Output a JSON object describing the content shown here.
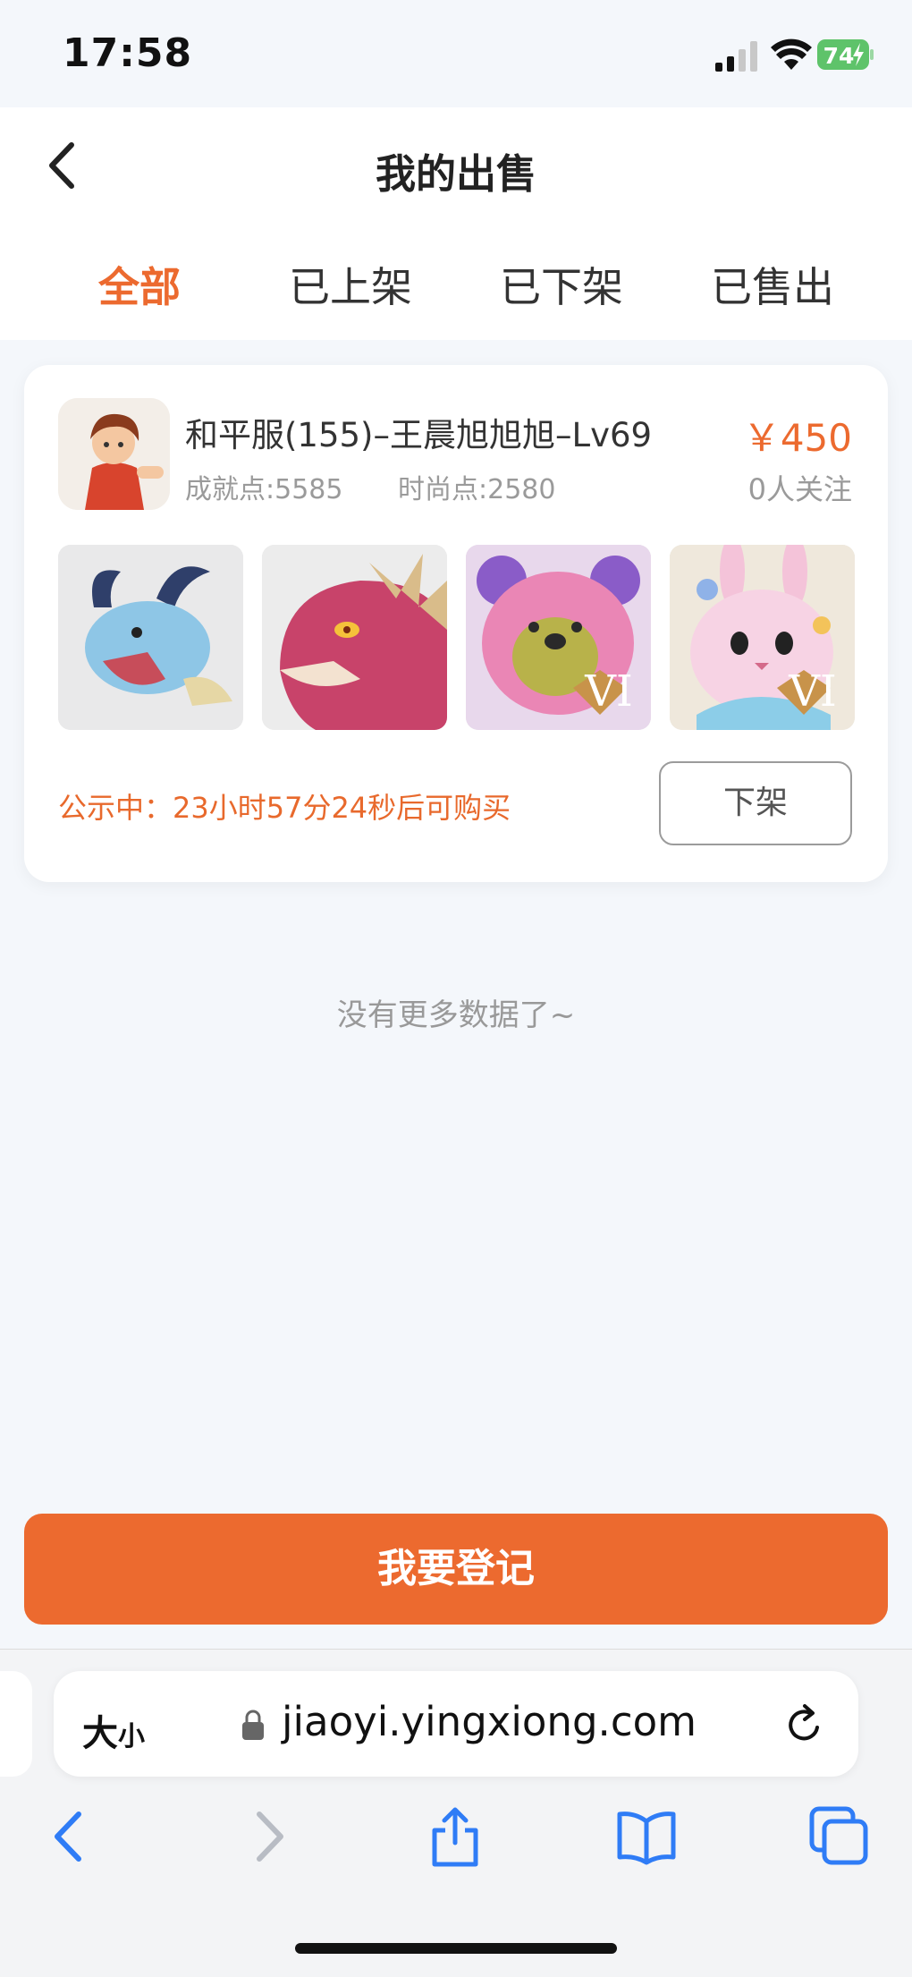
{
  "status_bar": {
    "time": "17:58",
    "battery": "74"
  },
  "header": {
    "title": "我的出售"
  },
  "tabs": [
    {
      "label": "全部",
      "active": true
    },
    {
      "label": "已上架",
      "active": false
    },
    {
      "label": "已下架",
      "active": false
    },
    {
      "label": "已售出",
      "active": false
    }
  ],
  "listing": {
    "title": "和平服(155)–王晨旭旭旭–Lv69",
    "achievement": "成就点:5585",
    "fashion": "时尚点:2580",
    "price": "￥450",
    "followers": "0人关注",
    "thumbnails": [
      "blue-dragon",
      "red-dragon",
      "pink-bear",
      "pink-rabbit"
    ],
    "thumb_badge": "VI",
    "notice": "公示中：23小时57分24秒后可购买",
    "delist_label": "下架"
  },
  "no_more": "没有更多数据了~",
  "register_label": "我要登记",
  "browser": {
    "size_label_big": "大",
    "size_label_small": "小",
    "url": "jiaoyi.yingxiong.com"
  },
  "colors": {
    "accent": "#ec6a2f",
    "ios_blue": "#2f7cf6"
  }
}
